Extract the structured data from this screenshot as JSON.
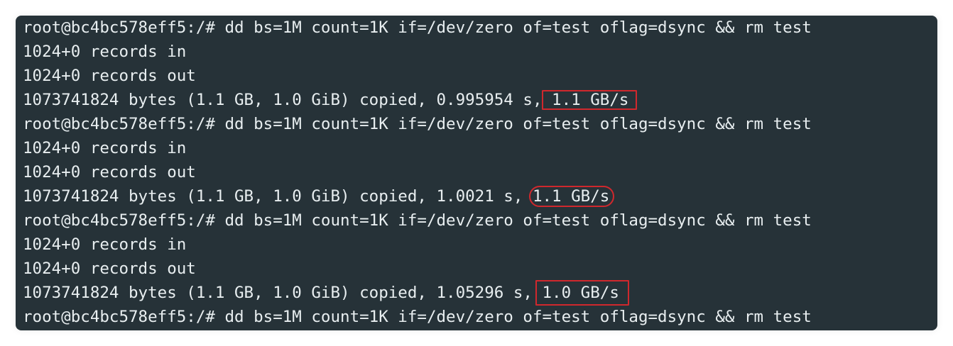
{
  "terminal": {
    "background": "#263238",
    "text_color": "#e8eef0",
    "highlight_color": "#d0282d",
    "lines": [
      {
        "text": "root@bc4bc578eff5:/# dd bs=1M count=1K if=/dev/zero of=test oflag=dsync && rm test"
      },
      {
        "text": "1024+0 records in"
      },
      {
        "text": "1024+0 records out"
      },
      {
        "prefix": "1073741824 bytes (1.1 GB, 1.0 GiB) copied, 0.995954 s, ",
        "rate": "1.1 GB/s"
      },
      {
        "text": "root@bc4bc578eff5:/# dd bs=1M count=1K if=/dev/zero of=test oflag=dsync && rm test"
      },
      {
        "text": "1024+0 records in"
      },
      {
        "text": "1024+0 records out"
      },
      {
        "prefix": "1073741824 bytes (1.1 GB, 1.0 GiB) copied, 1.0021 s, ",
        "rate": "1.1 GB/s"
      },
      {
        "text": "root@bc4bc578eff5:/# dd bs=1M count=1K if=/dev/zero of=test oflag=dsync && rm test"
      },
      {
        "text": "1024+0 records in"
      },
      {
        "text": "1024+0 records out"
      },
      {
        "prefix": "1073741824 bytes (1.1 GB, 1.0 GiB) copied, 1.05296 s, ",
        "rate": "1.0 GB/s"
      },
      {
        "text": "root@bc4bc578eff5:/# dd bs=1M count=1K if=/dev/zero of=test oflag=dsync && rm test"
      }
    ]
  }
}
